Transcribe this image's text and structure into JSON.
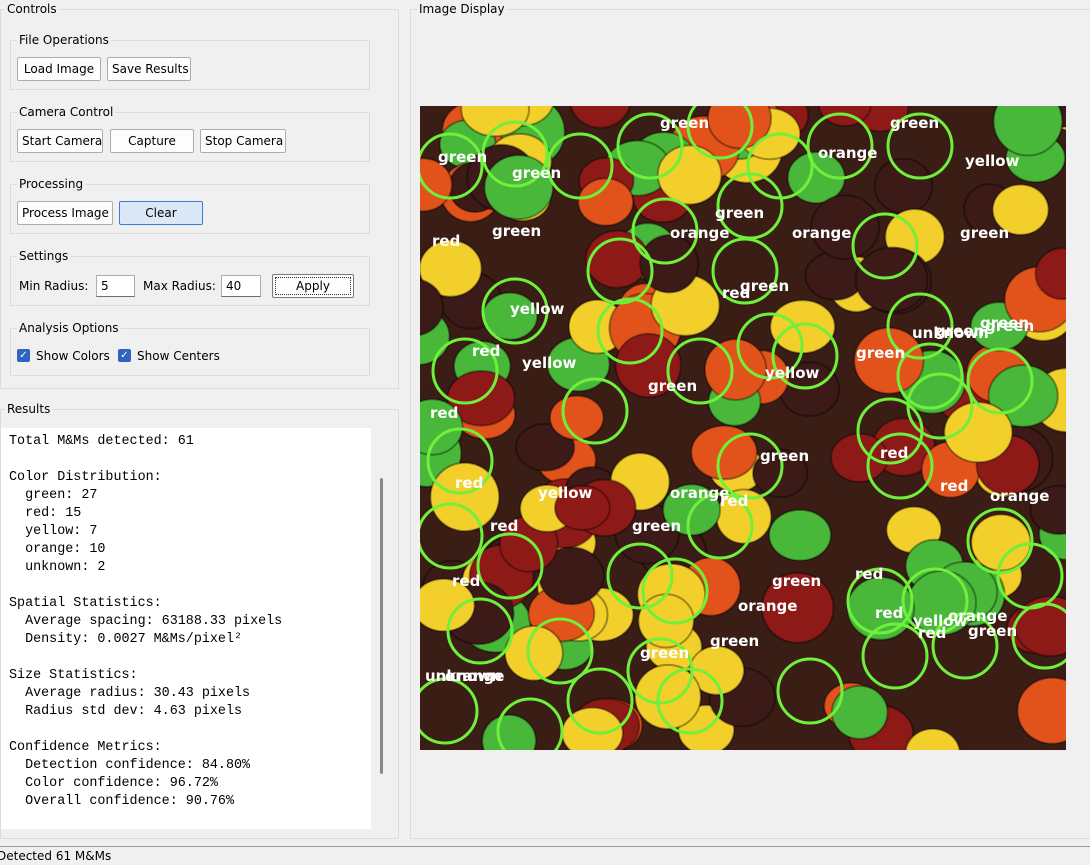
{
  "controls": {
    "title": "Controls",
    "file_ops": {
      "title": "File Operations",
      "load_label": "Load Image",
      "save_label": "Save Results"
    },
    "camera": {
      "title": "Camera Control",
      "start_label": "Start Camera",
      "capture_label": "Capture",
      "stop_label": "Stop Camera"
    },
    "processing": {
      "title": "Processing",
      "process_label": "Process Image",
      "clear_label": "Clear"
    },
    "settings": {
      "title": "Settings",
      "min_radius_label": "Min Radius:",
      "min_radius_value": "5",
      "max_radius_label": "Max Radius:",
      "max_radius_value": "40",
      "apply_label": "Apply"
    },
    "analysis": {
      "title": "Analysis Options",
      "show_colors_label": "Show Colors",
      "show_colors_checked": true,
      "show_centers_label": "Show Centers",
      "show_centers_checked": true
    }
  },
  "results": {
    "title": "Results",
    "lines": [
      "Total M&Ms detected: 61",
      "",
      "Color Distribution:",
      "  green: 27",
      "  red: 15",
      "  yellow: 7",
      "  orange: 10",
      "  unknown: 2",
      "",
      "Spatial Statistics:",
      "  Average spacing: 63188.33 pixels",
      "  Density: 0.0027 M&Ms/pixel²",
      "",
      "Size Statistics:",
      "  Average radius: 30.43 pixels",
      "  Radius std dev: 4.63 pixels",
      "",
      "Confidence Metrics:",
      "  Detection confidence: 84.80%",
      "  Color confidence: 96.72%",
      "  Overall confidence: 90.76%"
    ]
  },
  "display": {
    "title": "Image Display",
    "detection_circle_color": "#6ff03a",
    "candy_colors": {
      "green": "#49b83a",
      "red": "#8e1a18",
      "yellow": "#f2cf2a",
      "orange": "#e2531c",
      "brown": "#3b1a17"
    },
    "labels": [
      "green",
      "green",
      "orange",
      "orange",
      "green",
      "yellow",
      "green",
      "green",
      "green",
      "red",
      "green",
      "orange",
      "green",
      "green",
      "yellow",
      "green",
      "unknown",
      "green",
      "red",
      "red",
      "yellow",
      "green",
      "yellow",
      "green",
      "red",
      "red",
      "green",
      "red",
      "red",
      "orange",
      "yellow",
      "green",
      "orange",
      "red",
      "red",
      "red",
      "orange",
      "red",
      "orange",
      "yellow",
      "red",
      "green",
      "green",
      "green",
      "orange",
      "red",
      "green",
      "unknown"
    ]
  },
  "status": {
    "text": "Detected 61 M&Ms"
  }
}
